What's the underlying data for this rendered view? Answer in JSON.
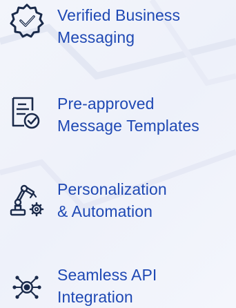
{
  "features": [
    {
      "icon": "verified-badge-icon",
      "line1": "Verified Business",
      "line2": "Messaging"
    },
    {
      "icon": "approved-document-icon",
      "line1": "Pre-approved",
      "line2": "Message Templates"
    },
    {
      "icon": "robot-arm-gear-icon",
      "line1": "Personalization",
      "line2": "& Automation"
    },
    {
      "icon": "api-integration-icon",
      "line1": "Seamless API",
      "line2": "Integration"
    }
  ],
  "colors": {
    "text": "#1f49b4",
    "icon": "#1a2a4a",
    "background": "#f2f4fb"
  }
}
